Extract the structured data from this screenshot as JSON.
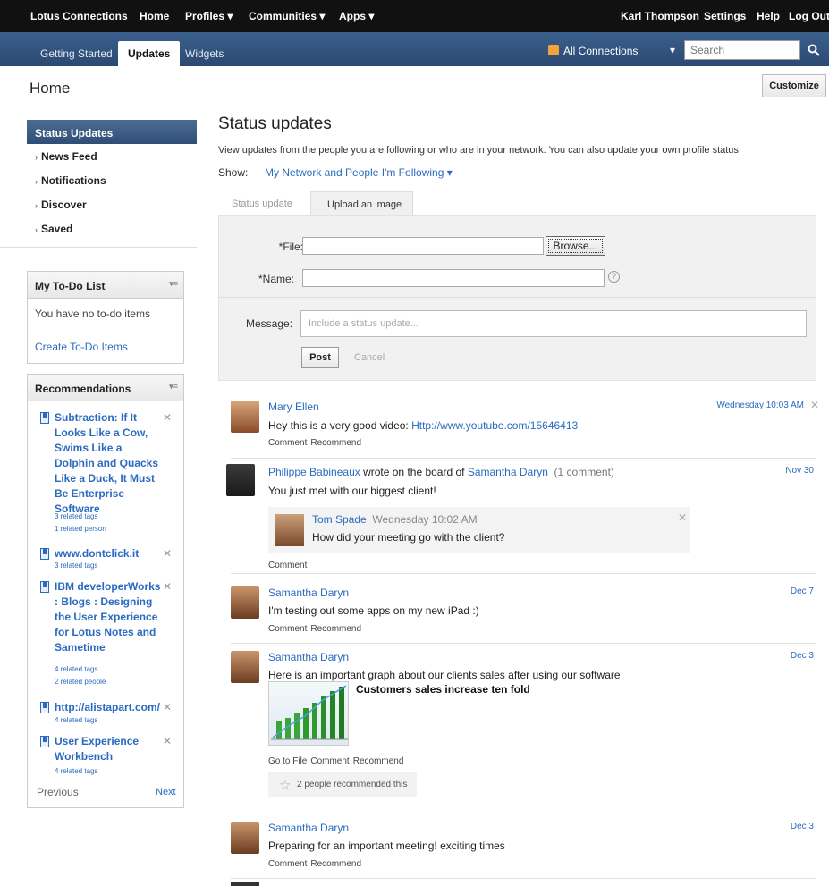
{
  "topbar": {
    "brand": "Lotus Connections",
    "home": "Home",
    "profiles": "Profiles ▾",
    "communities": "Communities ▾",
    "apps": "Apps ▾",
    "user": "Karl Thompson",
    "settings": "Settings",
    "help": "Help",
    "logout": "Log Out"
  },
  "navbar": {
    "tabs": [
      "Getting Started",
      "Updates",
      "Widgets"
    ],
    "connections": "All Connections",
    "search_placeholder": "Search"
  },
  "home": {
    "title": "Home",
    "customize": "Customize"
  },
  "leftnav": {
    "header": "Status Updates",
    "items": [
      "News Feed",
      "Notifications",
      "Discover",
      "Saved"
    ]
  },
  "todo": {
    "title": "My To-Do List",
    "empty": "You have no to-do items",
    "create": "Create To-Do Items"
  },
  "recommendations": {
    "title": "Recommendations",
    "items": [
      {
        "title": "Subtraction: If It Looks Like a Cow, Swims Like a Dolphin and Quacks Like a Duck, It Must Be Enterprise Software",
        "meta1": "3 related tags",
        "meta2": "1 related person"
      },
      {
        "title": "www.dontclick.it",
        "meta1": "3 related tags"
      },
      {
        "title": "IBM developerWorks : Blogs : Designing the User Experience for Lotus Notes and Sametime",
        "meta1": "4 related tags",
        "meta2": "2 related people"
      },
      {
        "title": "http://alistapart.com/",
        "meta1": "4 related tags"
      },
      {
        "title": "User Experience Workbench",
        "meta1": "4 related tags"
      }
    ],
    "previous": "Previous",
    "next": "Next"
  },
  "main": {
    "title": "Status updates",
    "description": "View updates from the people you are following or who are in your network. You can also update your own profile status.",
    "show_label": "Show:",
    "show_value": "My Network and People I'm Following ▾",
    "tabs": [
      "Status update",
      "Upload an image"
    ],
    "form": {
      "file_label": "*File:",
      "browse": "Browse...",
      "name_label": "*Name:",
      "message_label": "Message:",
      "message_placeholder": "Include a status update...",
      "post": "Post",
      "cancel": "Cancel"
    }
  },
  "feed": [
    {
      "name": "Mary Ellen",
      "text": "Hey this is a very good video: ",
      "link": "Http://www.youtube.com/15646413",
      "date": "Wednesday 10:03 AM",
      "actions": [
        "Comment",
        "Recommend"
      ]
    },
    {
      "name": "Philippe Babineaux",
      "mid": " wrote on the board of ",
      "target": "Samantha Daryn",
      "count": "(1 comment)",
      "text": "You just met with our biggest client!",
      "date": "Nov 30",
      "comment": {
        "name": "Tom Spade",
        "time": "Wednesday 10:02 AM",
        "text": "How did your meeting go with the client?"
      },
      "actions": [
        "Comment"
      ]
    },
    {
      "name": "Samantha Daryn",
      "text": "I'm testing out some apps on my new iPad :)",
      "date": "Dec 7",
      "actions": [
        "Comment",
        "Recommend"
      ]
    },
    {
      "name": "Samantha Daryn",
      "text": "Here is an important graph about our clients sales after using our software",
      "date": "Dec 3",
      "attachment": "Customers sales increase ten fold",
      "actions": [
        "Go to File",
        "Comment",
        "Recommend"
      ],
      "recommended": "2 people recommended this"
    },
    {
      "name": "Samantha Daryn",
      "text": "Preparing for an important meeting! exciting times",
      "date": "Dec 3",
      "actions": [
        "Comment",
        "Recommend"
      ]
    }
  ]
}
